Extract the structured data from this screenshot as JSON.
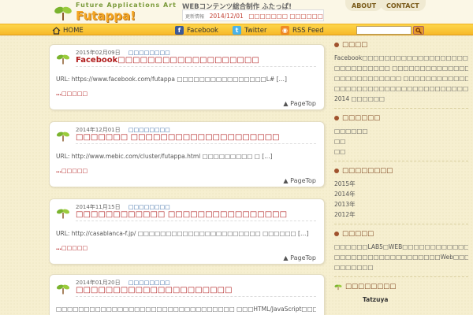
{
  "header": {
    "tagline": "Future Applications Art",
    "brand": "Futappa!",
    "site_title": "WEBコンテンツ総合制作 ふたっぱ!",
    "news_label": "更新情報",
    "news_date": "2014/12/01",
    "news_text": "□□□□□□□ □□□□□□□□□□□□□□□□□□□□□□",
    "tab_about": "ABOUT",
    "tab_contact": "CONTACT"
  },
  "nav": {
    "home": "HOME",
    "facebook": "Facebook",
    "twitter": "Twitter",
    "rss": "RSS Feed"
  },
  "posts": [
    {
      "date": "2015年02月09日",
      "category": "□□□□□□□□",
      "title": "Facebook□□□□□□□□□□□□□□□□□□□",
      "excerpt": "URL: https://www.facebook.com/futappa □□□□□□□□□□□□□□□□L# […]",
      "more": "…□□□□□",
      "pagetop": "PageTop"
    },
    {
      "date": "2014年12月01日",
      "category": "□□□□□□□□",
      "title": "□□□□□□□ □□□□□□□□□□□□□□□□□□□□",
      "excerpt": "URL: http://www.mebic.com/cluster/futappa.html □□□□□□□□□ □ […]",
      "more": "…□□□□□",
      "pagetop": "PageTop"
    },
    {
      "date": "2014年11月15日",
      "category": "□□□□□□□□",
      "title": "□□□□□□□□□□□□ □□□□□□□□□□□□□□□□",
      "excerpt": "URL: http://casablanca-f.jp/ □□□□□□□□□□□□□□□□□□□□□□ □□□□□□ […]",
      "more": "…□□□□□",
      "pagetop": "PageTop"
    },
    {
      "date": "2014年01月20日",
      "category": "□□□□□□□□",
      "title": "□□□□□□□□□□□□□□□□□□□□□",
      "excerpt": "□□□□□□□□□□□□□□□□□□□□□□□□□□□□□□□□ □□□HTML/JavaScript□□□□ […]"
    }
  ],
  "sidebar": {
    "about_head": "□□□□",
    "about_lines": [
      "Facebook□□□□□□□□□□□□□□□□□□□",
      "□□□□□□□□□□ □□□□□□□□□□□□□□□□□",
      "□□□□□□□□□□□□ □□□□□□□□□□□□□□□",
      "□□□□□□□□□□□□□□□□□□□□□□□□",
      "2014 □□□□□□"
    ],
    "cat_head": "□□□□□□",
    "cat_items": [
      "□□□□□□",
      "□□",
      "□□"
    ],
    "archive_head": "□□□□□□□□",
    "archive_items": [
      "2015年",
      "2014年",
      "2013年",
      "2012年"
    ],
    "links_head": "□□□□□",
    "link_lines": [
      "□□□□□□LAB5□WEB□□□□□□□□□□□□□□",
      "□□□□□□□□□□□□□□□□□□□Web□□□□□□□",
      "□□□□□□□"
    ],
    "profile_head": "□□□□□□□□",
    "profile_name": "Tatzuya"
  },
  "colors": {
    "accent": "#f7b928",
    "title_red": "#b01b1b",
    "brand_orange": "#f5a623"
  }
}
